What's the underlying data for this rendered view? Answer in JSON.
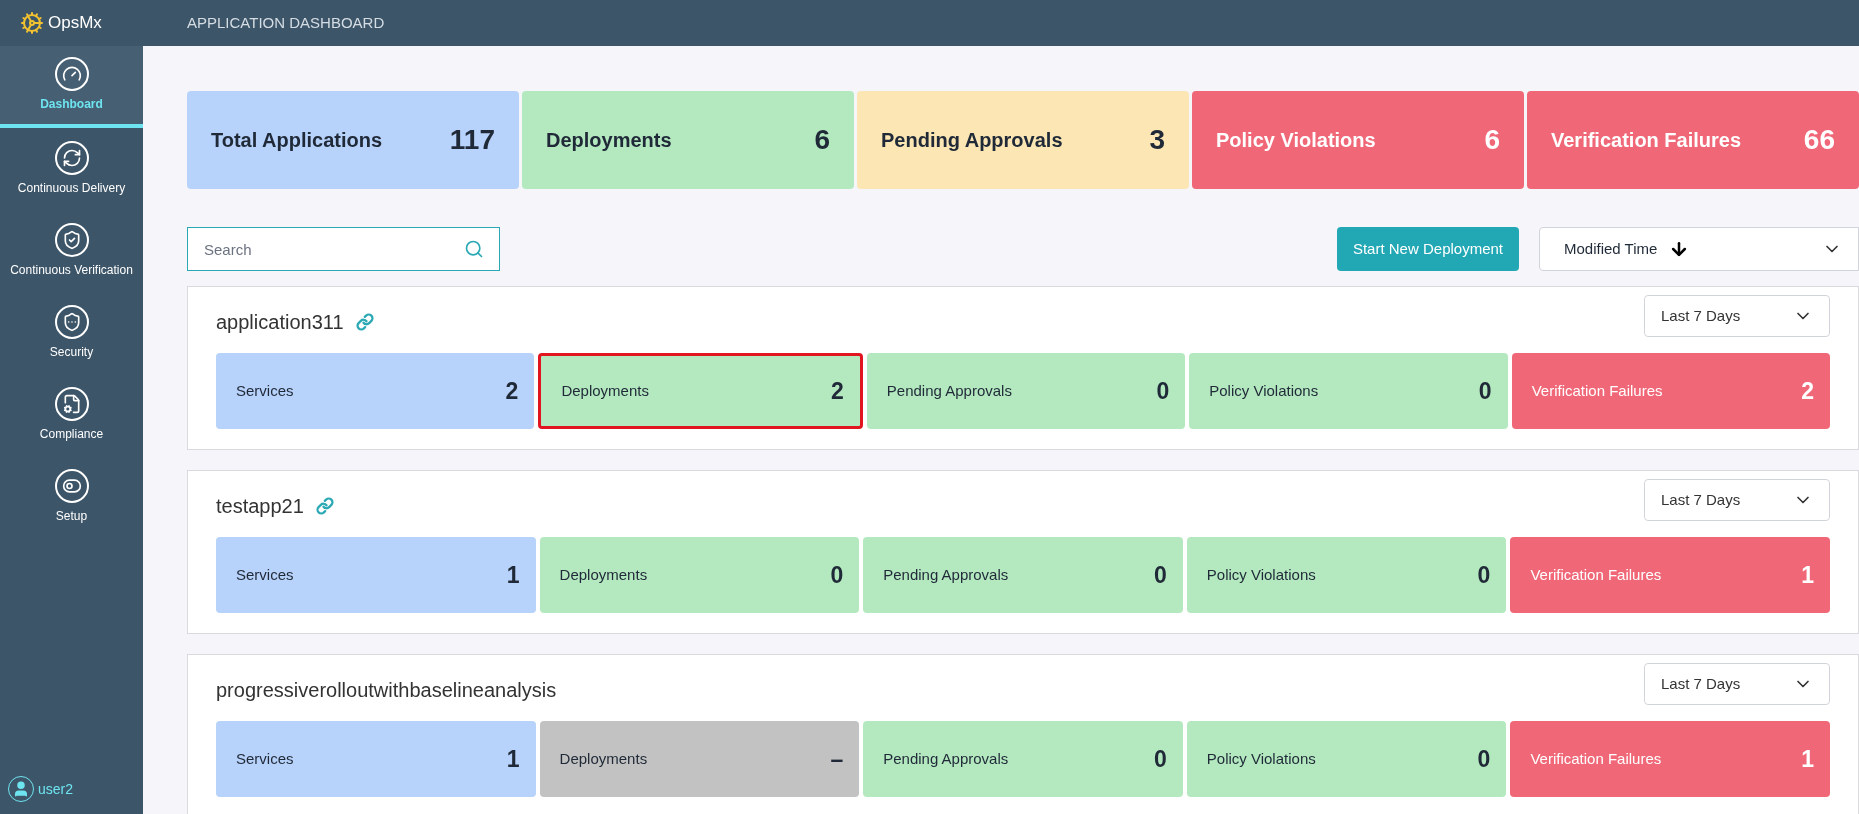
{
  "header": {
    "logo": "OpsMx",
    "title": "APPLICATION DASHBOARD"
  },
  "sidebar": {
    "items": [
      {
        "label": "Dashboard",
        "selected": true
      },
      {
        "label": "Continuous Delivery",
        "selected": false
      },
      {
        "label": "Continuous Verification",
        "selected": false
      },
      {
        "label": "Security",
        "selected": false
      },
      {
        "label": "Compliance",
        "selected": false
      },
      {
        "label": "Setup",
        "selected": false
      }
    ],
    "user": "user2"
  },
  "stats": [
    {
      "label": "Total Applications",
      "value": "117",
      "color": "#b8d3fb"
    },
    {
      "label": "Deployments",
      "value": "6",
      "color": "#b4e9c0"
    },
    {
      "label": "Pending Approvals",
      "value": "3",
      "color": "#fbe6b4"
    },
    {
      "label": "Policy Violations",
      "value": "6",
      "color": "#f06878"
    },
    {
      "label": "Verification Failures",
      "value": "66",
      "color": "#f06878"
    }
  ],
  "toolbar": {
    "search": {
      "placeholder": "Search"
    },
    "button": "Start New Deployment",
    "sort": "Modified Time"
  },
  "apps": [
    {
      "name": "application311",
      "linked": true,
      "period": "Last 7 Days",
      "tiles": [
        {
          "label": "Services",
          "value": "2",
          "color": "#b8d3fb",
          "highlighted": false
        },
        {
          "label": "Deployments",
          "value": "2",
          "color": "#b4e9c0",
          "highlighted": true
        },
        {
          "label": "Pending Approvals",
          "value": "0",
          "color": "#b4e9c0",
          "highlighted": false
        },
        {
          "label": "Policy Violations",
          "value": "0",
          "color": "#b4e9c0",
          "highlighted": false
        },
        {
          "label": "Verification Failures",
          "value": "2",
          "color": "#f06878",
          "highlighted": false
        }
      ]
    },
    {
      "name": "testapp21",
      "linked": true,
      "period": "Last 7 Days",
      "tiles": [
        {
          "label": "Services",
          "value": "1",
          "color": "#b8d3fb",
          "highlighted": false
        },
        {
          "label": "Deployments",
          "value": "0",
          "color": "#b4e9c0",
          "highlighted": false
        },
        {
          "label": "Pending Approvals",
          "value": "0",
          "color": "#b4e9c0",
          "highlighted": false
        },
        {
          "label": "Policy Violations",
          "value": "0",
          "color": "#b4e9c0",
          "highlighted": false
        },
        {
          "label": "Verification Failures",
          "value": "1",
          "color": "#f06878",
          "highlighted": false
        }
      ]
    },
    {
      "name": "progressiverolloutwithbaselineanalysis",
      "linked": false,
      "period": "Last 7 Days",
      "tiles": [
        {
          "label": "Services",
          "value": "1",
          "color": "#b8d3fb",
          "highlighted": false
        },
        {
          "label": "Deployments",
          "value": "–",
          "color": "#c2c2c2",
          "highlighted": false
        },
        {
          "label": "Pending Approvals",
          "value": "0",
          "color": "#b4e9c0",
          "highlighted": false
        },
        {
          "label": "Policy Violations",
          "value": "0",
          "color": "#b4e9c0",
          "highlighted": false
        },
        {
          "label": "Verification Failures",
          "value": "1",
          "color": "#f06878",
          "highlighted": false
        }
      ]
    }
  ]
}
